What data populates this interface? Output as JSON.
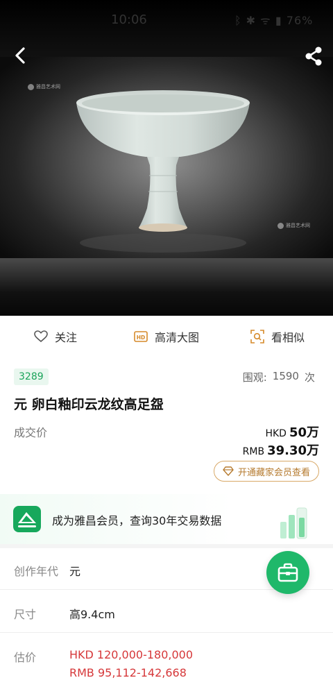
{
  "status_bar": {
    "time": "10:06",
    "indicators": "ᛒ ✱ ᯤ ▮ 76%"
  },
  "hero": {
    "watermark_text": "雅昌艺术网"
  },
  "actions": [
    {
      "label": "关注",
      "icon": "heart-icon"
    },
    {
      "label": "高清大图",
      "icon": "hd-icon"
    },
    {
      "label": "看相似",
      "icon": "image-search-icon"
    }
  ],
  "lot": {
    "number": "3289",
    "views_label": "围观:",
    "views_count": "1590",
    "views_unit": "次",
    "title": "元 卵白釉印云龙纹高足盌",
    "deal_label": "成交价",
    "price_hkd_currency": "HKD",
    "price_hkd_value": "50万",
    "price_rmb_currency": "RMB",
    "price_rmb_value": "39.30万",
    "vip_button": "开通藏家会员查看"
  },
  "banner": {
    "text": "成为雅昌会员，查询30年交易数据"
  },
  "details": [
    {
      "label": "创作年代",
      "value": "元"
    },
    {
      "label": "尺寸",
      "value": "高9.4cm"
    },
    {
      "label": "估价",
      "value_hkd": "HKD  120,000-180,000",
      "value_rmb": "RMB 95,112-142,668"
    }
  ],
  "colors": {
    "accent_green": "#1fb86a",
    "estimate_red": "#d6383a",
    "vip_gold": "#b57a2e"
  }
}
